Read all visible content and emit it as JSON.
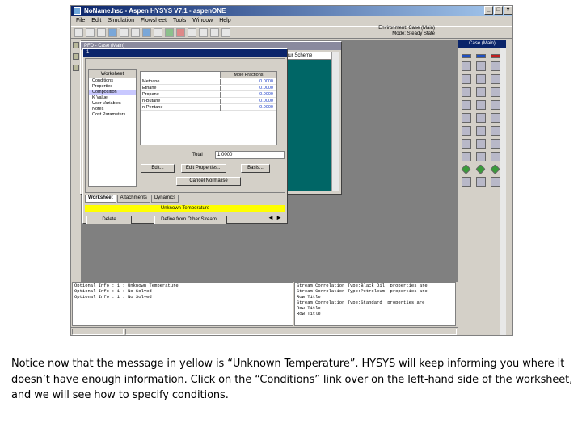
{
  "window": {
    "title": "NoName.hsc - Aspen HYSYS V7.1 - aspenONE",
    "min": "_",
    "max": "□",
    "close": "×"
  },
  "menu": [
    "File",
    "Edit",
    "Simulation",
    "Flowsheet",
    "Tools",
    "Window",
    "Help"
  ],
  "environment": {
    "line1": "Environment: Case (Main)",
    "line2": "Mode: Steady State"
  },
  "pfd": {
    "title": "PFD - Case (Main)",
    "scheme": "Colour Scheme"
  },
  "worksheet": {
    "title": "1",
    "nav_header": "Worksheet",
    "nav_items": [
      "Conditions",
      "Properties",
      "Composition",
      "K Value",
      "User Variables",
      "Notes",
      "Cost Parameters"
    ],
    "grid_header": "Mole Fractions",
    "rows": [
      {
        "name": "Methane",
        "value": "0.0000"
      },
      {
        "name": "Ethane",
        "value": "0.0000"
      },
      {
        "name": "Propane",
        "value": "0.0000"
      },
      {
        "name": "n-Butane",
        "value": "0.0000"
      },
      {
        "name": "n-Pentane",
        "value": "0.0000"
      }
    ],
    "total_label": "Total",
    "total_value": "1.0000",
    "buttons": {
      "edit": "Edit...",
      "edit_props": "Edit Properties...",
      "basis": "Basis...",
      "normalize": "Cancel Normalise"
    },
    "tabs": [
      "Worksheet",
      "Attachments",
      "Dynamics"
    ],
    "status": "Unknown Temperature",
    "delete": "Delete",
    "define": "Define from Other Stream...",
    "nav_arrows": "◄ ►"
  },
  "palette": {
    "title": "Case (Main)"
  },
  "trace": {
    "left": [
      "Optional Info : 1 : Unknown Temperature",
      "Optional Info : 1 : No Solved",
      "Optional Info : 1 : No Solved"
    ],
    "right": [
      "Stream Correlation Type:Black Oil  properties are",
      "Stream Correlation Type:Petroleum  properties are",
      "Row Title",
      "Stream Correlation Type:Standard  properties are",
      "Row Title",
      "Row Title"
    ]
  },
  "caption": "Notice now that the message in yellow is “Unknown Temperature”. HYSYS will keep informing you where it doesn’t have enough information. Click on the “Conditions” link over on the left-hand side of the worksheet, and we will see how to specify conditions."
}
